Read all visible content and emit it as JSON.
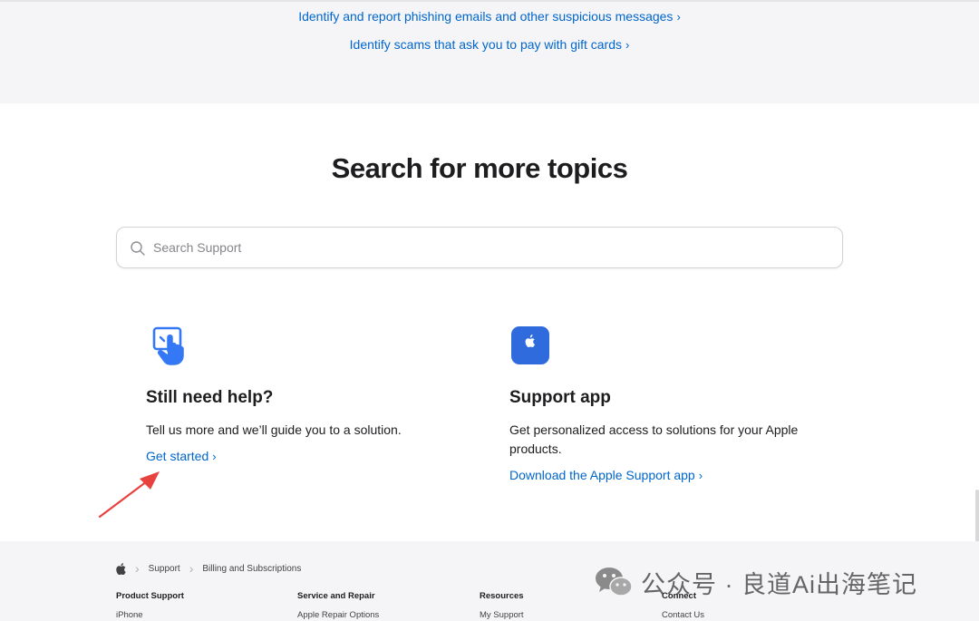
{
  "top_links": [
    {
      "label": "Identify and report phishing emails and other suspicious messages",
      "chevron": "›"
    },
    {
      "label": "Identify scams that ask you to pay with gift cards",
      "chevron": "›"
    }
  ],
  "search": {
    "title": "Search for more topics",
    "placeholder": "Search Support",
    "value": "",
    "icon": "search-icon"
  },
  "cards": {
    "help": {
      "icon": "touch-screen-hand-icon",
      "title": "Still need help?",
      "description": "Tell us more and we’ll guide you to a solution.",
      "link_label": "Get started",
      "link_chevron": "›"
    },
    "app": {
      "icon": "apple-support-app-icon",
      "title": "Support app",
      "description": "Get personalized access to solutions for your Apple products.",
      "link_label": "Download the Apple Support app",
      "link_chevron": "›"
    }
  },
  "annotation": {
    "icon": "red-arrow-icon",
    "color": "#e8423f"
  },
  "footer": {
    "breadcrumb": [
      {
        "label": "",
        "icon": "apple-logo-icon"
      },
      {
        "label": "Support"
      },
      {
        "label": "Billing and Subscriptions"
      }
    ],
    "breadcrumb_separator": "›",
    "columns": [
      {
        "title": "Product Support",
        "items": [
          "iPhone"
        ]
      },
      {
        "title": "Service and Repair",
        "items": [
          "Apple Repair Options"
        ]
      },
      {
        "title": "Resources",
        "items": [
          "My Support"
        ]
      },
      {
        "title": "Connect",
        "items": [
          "Contact Us"
        ]
      }
    ]
  },
  "watermark": {
    "text": "公众号 · 良道Ai出海笔记",
    "icon": "wechat-icon"
  },
  "colors": {
    "link": "#0066cc",
    "band": "#f5f5f7",
    "app_icon": "#2f6bdc",
    "help_icon": "#3478f6"
  }
}
